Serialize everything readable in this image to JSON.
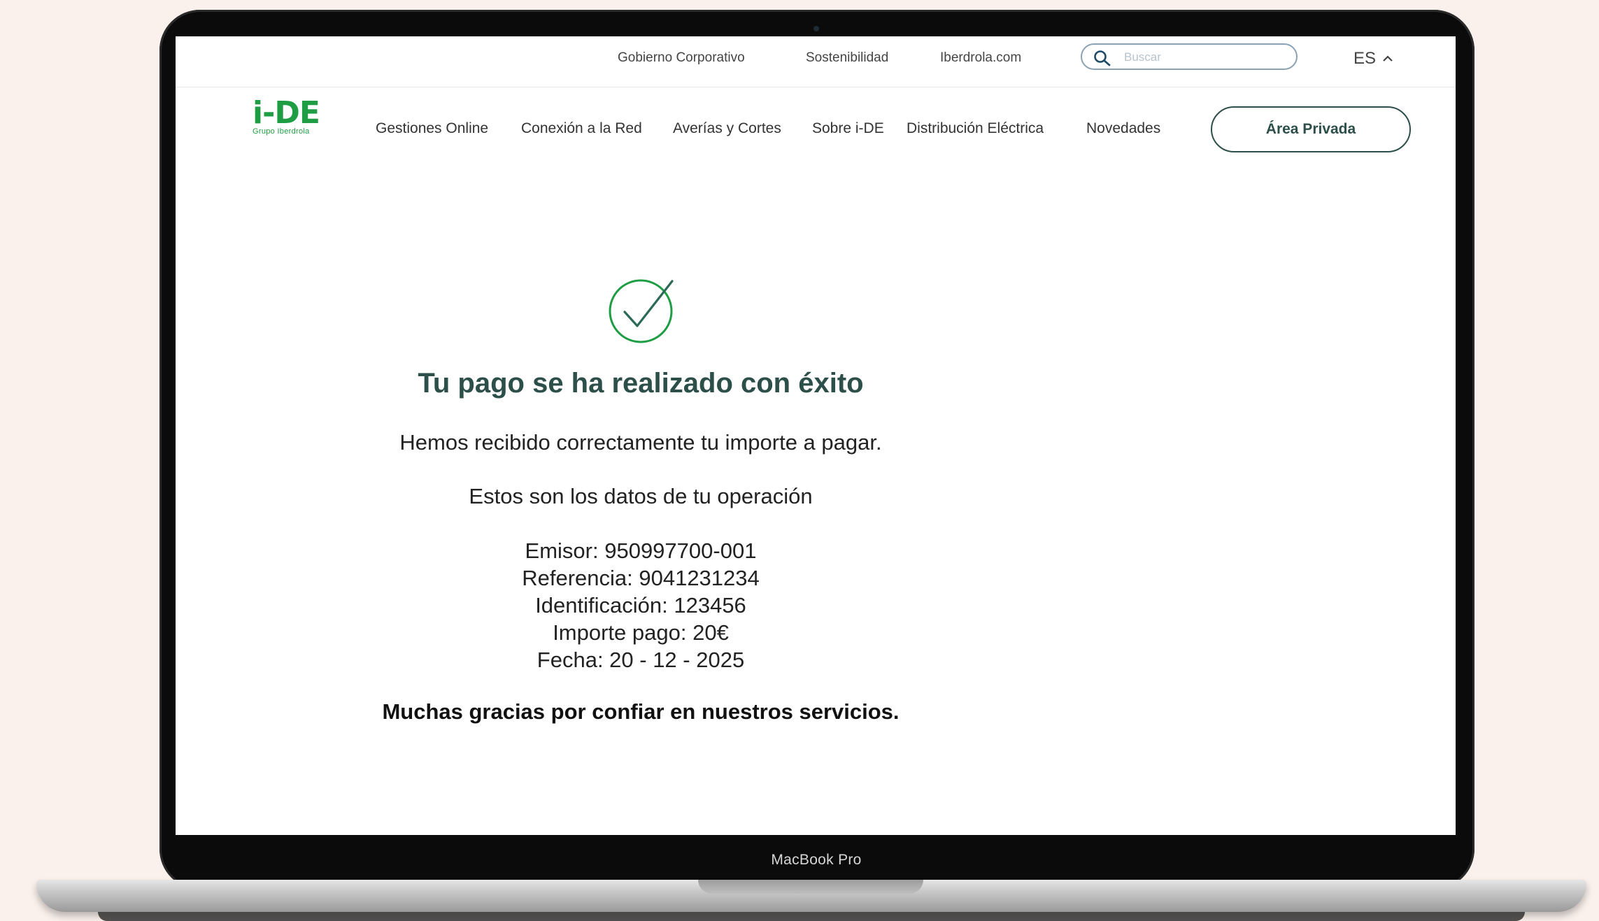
{
  "device": {
    "model_label": "MacBook Pro"
  },
  "topbar": {
    "links": [
      "Gobierno Corporativo",
      "Sostenibilidad",
      "Iberdrola.com"
    ],
    "search_placeholder": "Buscar",
    "language": "ES"
  },
  "header": {
    "logo_text": "i-DE",
    "logo_subtext": "Grupo Iberdrola",
    "nav": [
      "Gestiones Online",
      "Conexión a la Red",
      "Averías y Cortes",
      "Sobre i-DE",
      "Distribución Eléctrica",
      "Novedades"
    ],
    "private_area_label": "Área Privada"
  },
  "confirmation": {
    "title": "Tu pago se ha realizado con éxito",
    "message": "Hemos recibido correctamente tu importe a pagar.",
    "details_intro": "Estos son los datos de tu operación",
    "details": [
      "Emisor: 950997700-001",
      "Referencia: 9041231234",
      "Identificación: 123456",
      "Importe pago: 20€",
      "Fecha: 20 - 12 - 2025"
    ],
    "thanks": "Muchas gracias por confiar en nuestros servicios."
  },
  "colors": {
    "brand_green": "#1f9d44",
    "heading_green": "#2c4f4a",
    "accent_blue": "#29a7d9"
  }
}
